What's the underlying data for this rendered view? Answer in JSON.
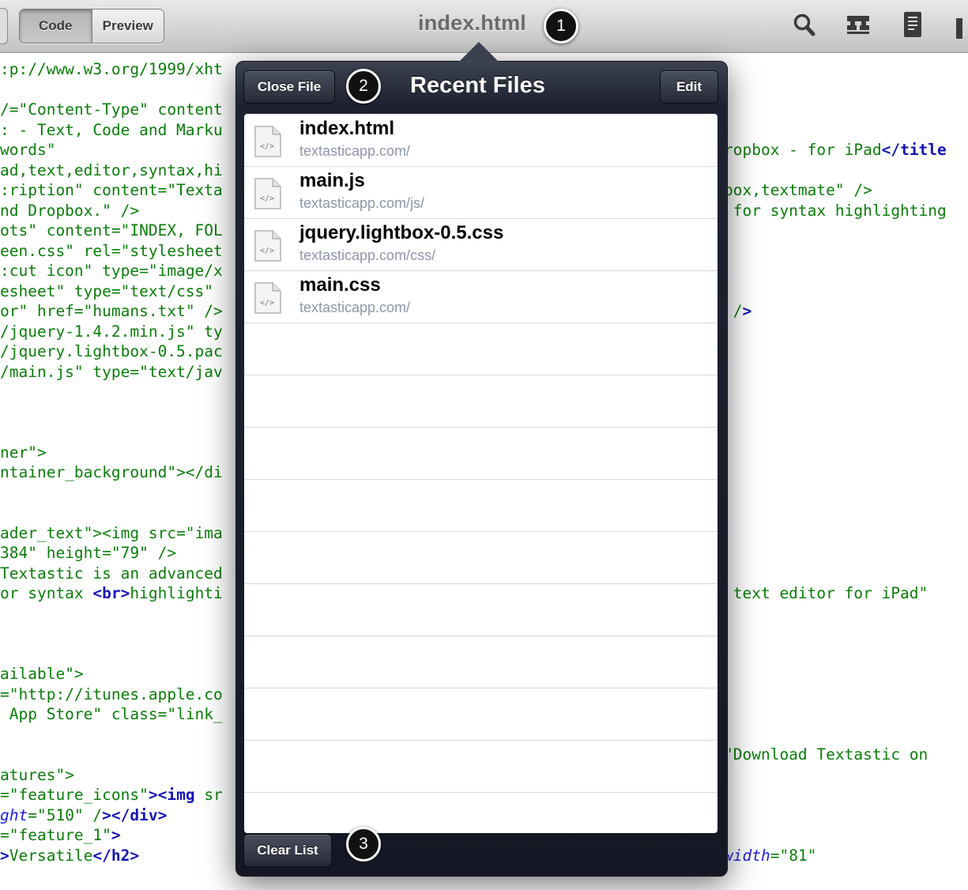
{
  "toolbar": {
    "code_label": "Code",
    "preview_label": "Preview",
    "title": "index.html",
    "icons": [
      "search-icon",
      "outline-icon",
      "document-icon"
    ]
  },
  "callouts": [
    "1",
    "2",
    "3"
  ],
  "recent_files": {
    "title": "Recent Files",
    "close_label": "Close File",
    "edit_label": "Edit",
    "clear_label": "Clear List",
    "files": [
      {
        "name": "index.html",
        "path": "textasticapp.com/"
      },
      {
        "name": "main.js",
        "path": "textasticapp.com/js/"
      },
      {
        "name": "jquery.lightbox-0.5.css",
        "path": "textasticapp.com/css/"
      },
      {
        "name": "main.css",
        "path": "textasticapp.com/"
      }
    ]
  },
  "code": {
    "left": [
      ":p://www.w3.org/1999/xht",
      "",
      "/=\"Content-Type\" content",
      ": - Text, Code and Marku",
      "words\"",
      "ad,text,editor,syntax,hi",
      ":ription\" content=\"Texta",
      "nd Dropbox.\" />",
      "ots\" content=\"INDEX, FOL",
      "een.css\" rel=\"stylesheet",
      ":cut icon\" type=\"image/x",
      "esheet\" type=\"text/css\"",
      "or\" href=\"humans.txt\" />",
      "/jquery-1.4.2.min.js\" ty",
      "/jquery.lightbox-0.5.pac",
      "/main.js\" type=\"text/jav",
      "",
      "",
      "",
      "ner\">",
      "ntainer_background\"></di",
      "",
      "",
      "ader_text\"><img src=\"ima",
      "384\" height=\"79\" />",
      "Textastic is an advanced",
      "or syntax <br>highlighti",
      "",
      "",
      "",
      "ailable\">",
      "=\"http://itunes.apple.co",
      " App Store\" class=\"link_",
      "",
      "",
      "atures\">",
      "=\"feature_icons\"><img sr",
      "ght=\"510\" /></div>",
      "=\"feature_1\">",
      ">Versatile</h2>"
    ],
    "right": [
      {
        "line": 5,
        "text": "ropbox - for iPad</title"
      },
      {
        "line": 7,
        "text": "box,textmate\" />"
      },
      {
        "line": 8,
        "text": " for syntax highlighting"
      },
      {
        "line": 13,
        "text": " />"
      },
      {
        "line": 27,
        "text": " text editor for iPad\""
      },
      {
        "line": 35,
        "text": "\"Download Textastic on"
      },
      {
        "line": 40,
        "text": "width=\"81\""
      }
    ]
  }
}
